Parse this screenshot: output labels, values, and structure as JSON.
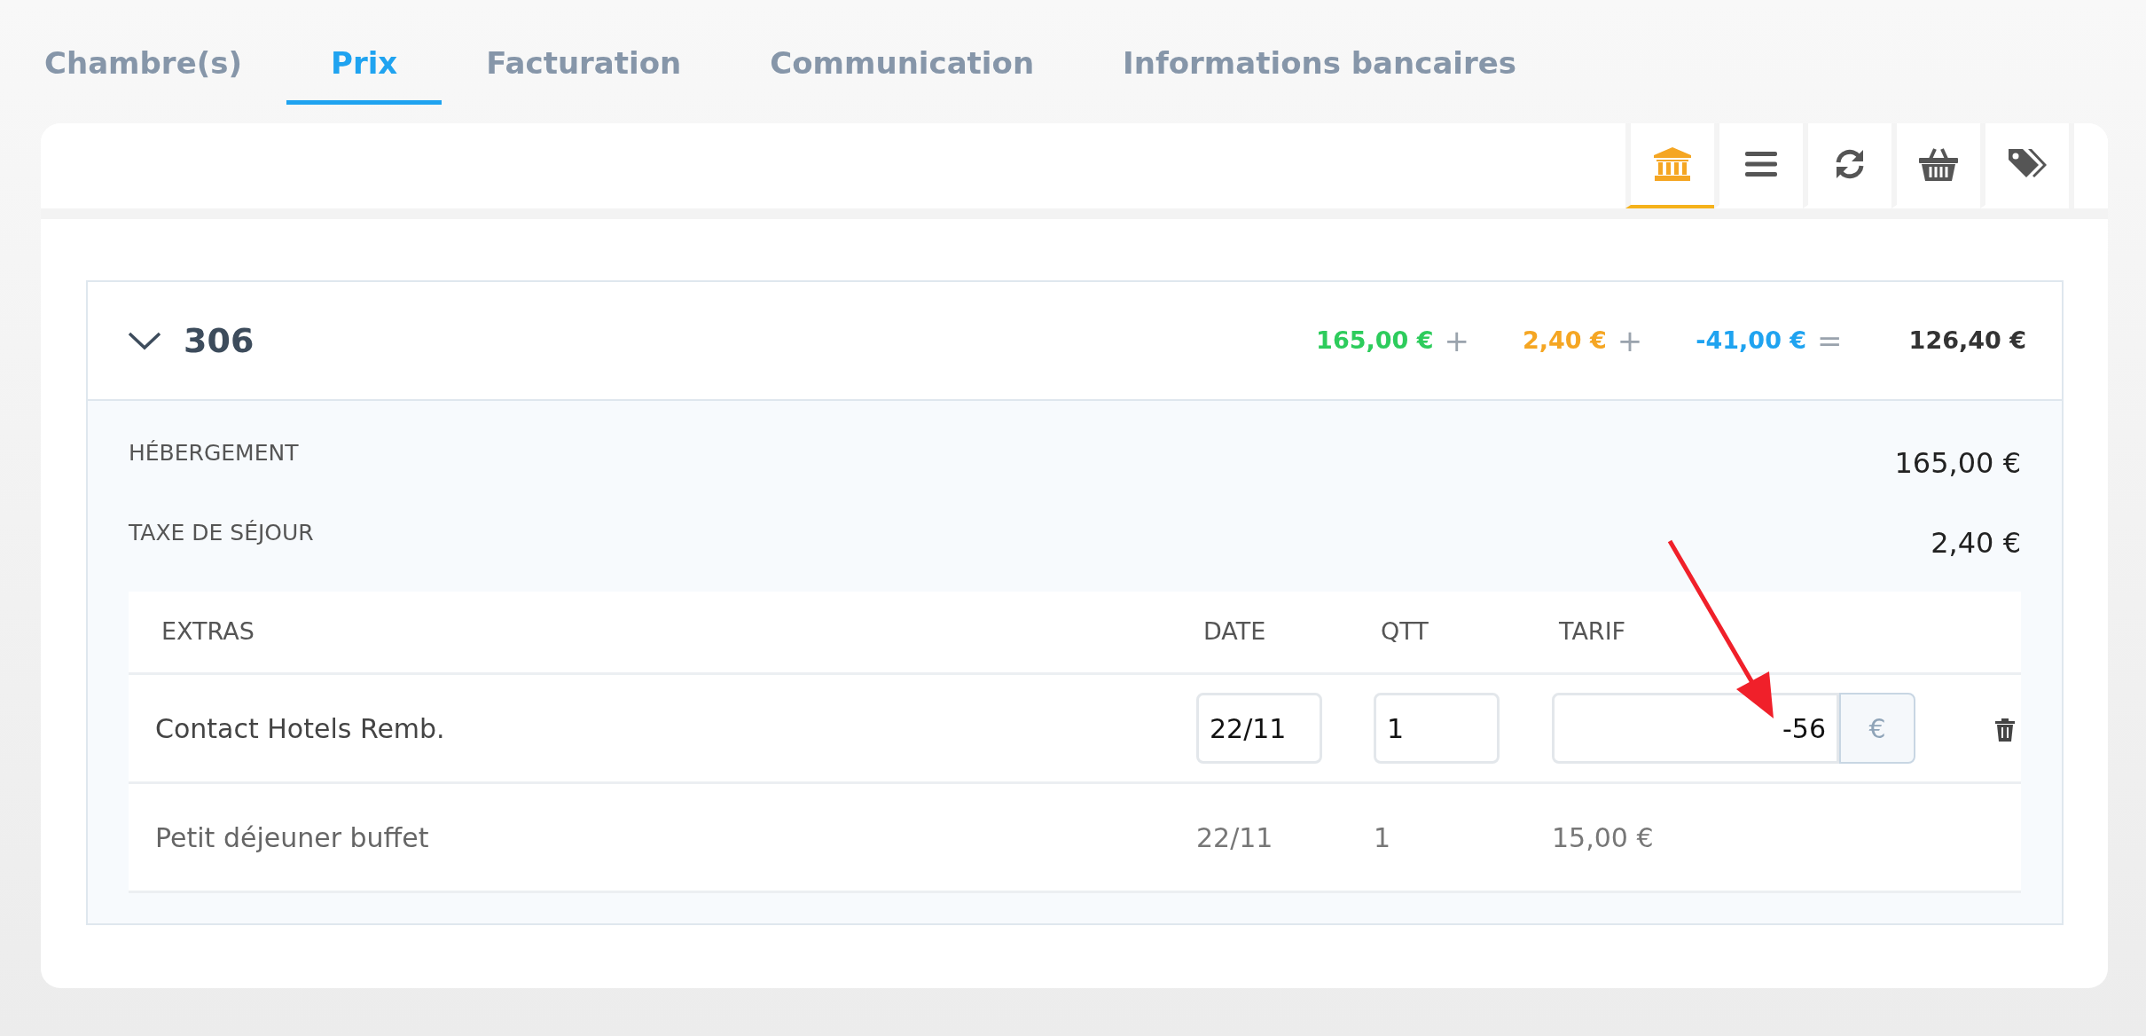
{
  "tabs": [
    {
      "label": "Chambre(s)",
      "selected": false
    },
    {
      "label": "Prix",
      "selected": true
    },
    {
      "label": "Facturation",
      "selected": false
    },
    {
      "label": "Communication",
      "selected": false
    },
    {
      "label": "Informations bancaires",
      "selected": false
    }
  ],
  "toolbar": [
    {
      "selected": true
    },
    {
      "selected": false
    },
    {
      "selected": false
    },
    {
      "selected": false
    },
    {
      "selected": false
    }
  ],
  "room": {
    "number": "306",
    "expanded": true,
    "totals": [
      {
        "amount": "165,00 €",
        "color": "#2dcc5c",
        "operator": "+"
      },
      {
        "amount": "2,40 €",
        "color": "#f5a623",
        "operator": "+"
      },
      {
        "amount": "-41,00 €",
        "color": "#1fa3f0",
        "operator": "="
      },
      {
        "amount": "126,40 €",
        "color": "#333333"
      }
    ],
    "lines": [
      {
        "label": "HÉBERGEMENT",
        "amount": "165,00 €"
      },
      {
        "label": "TAXE DE SÉJOUR",
        "amount": "2,40 €"
      }
    ],
    "extras": {
      "columns": [
        "EXTRAS",
        "DATE",
        "QTT",
        "TARIF"
      ],
      "rows": [
        {
          "kind": "editable",
          "name": "Contact Hotels Remb.",
          "date": "22/11",
          "qty": "1",
          "tarif": "-56",
          "currency": "€"
        },
        {
          "kind": "fixed",
          "name": "Petit déjeuner buffet",
          "date": "22/11",
          "qty": "1",
          "tarif": "15,00 €"
        }
      ]
    }
  },
  "annotation": {
    "kind": "arrow"
  }
}
